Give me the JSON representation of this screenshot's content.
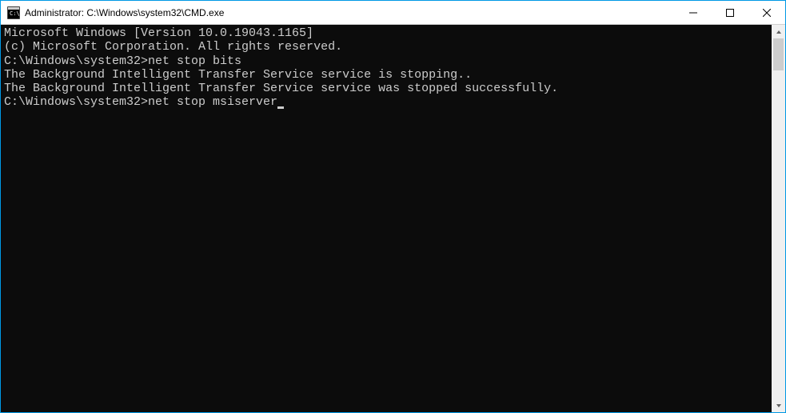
{
  "window": {
    "title": "Administrator: C:\\Windows\\system32\\CMD.exe"
  },
  "terminal": {
    "line1": "Microsoft Windows [Version 10.0.19043.1165]",
    "line2": "(c) Microsoft Corporation. All rights reserved.",
    "blank1": "",
    "prompt1_path": "C:\\Windows\\system32>",
    "prompt1_cmd": "net stop bits",
    "output1": "The Background Intelligent Transfer Service service is stopping..",
    "output2": "The Background Intelligent Transfer Service service was stopped successfully.",
    "blank2": "",
    "blank3": "",
    "prompt2_path": "C:\\Windows\\system32>",
    "prompt2_cmd": "net stop msiserver"
  }
}
